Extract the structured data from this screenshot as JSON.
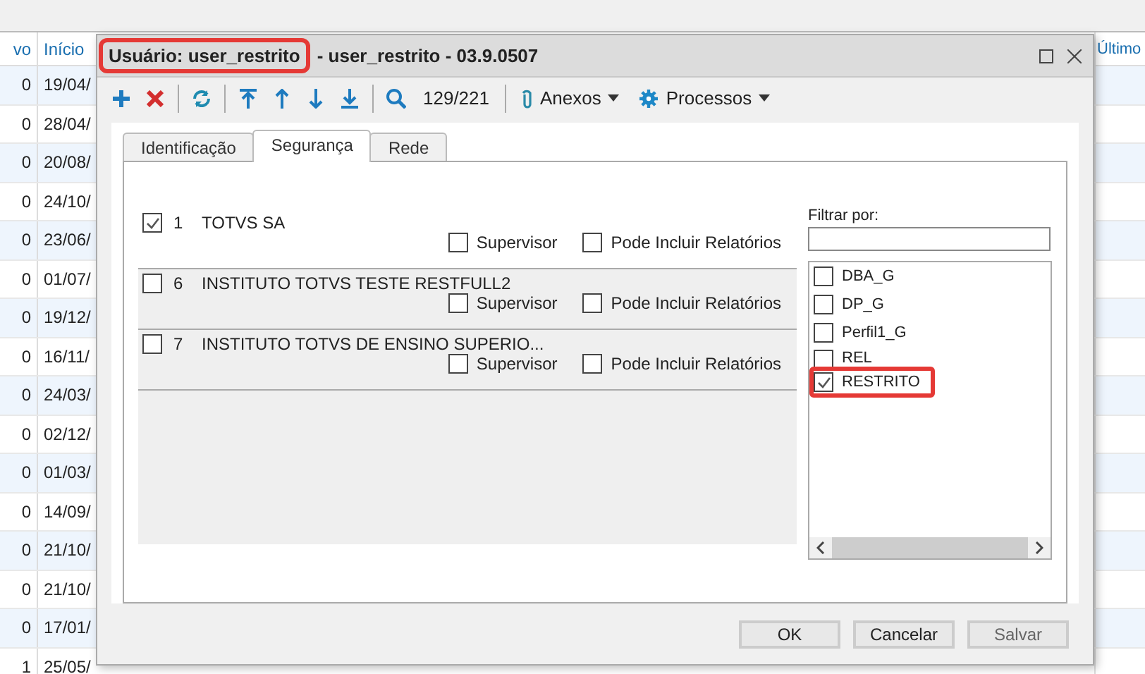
{
  "background_table": {
    "columns": [
      "vo",
      "Início",
      "Último"
    ],
    "rows": [
      {
        "value": "0",
        "date": "19/04/"
      },
      {
        "value": "0",
        "date": "28/04/"
      },
      {
        "value": "0",
        "date": "20/08/"
      },
      {
        "value": "0",
        "date": "24/10/"
      },
      {
        "value": "0",
        "date": "23/06/"
      },
      {
        "value": "0",
        "date": "01/07/"
      },
      {
        "value": "0",
        "date": "19/12/"
      },
      {
        "value": "0",
        "date": "16/11/"
      },
      {
        "value": "0",
        "date": "24/03/"
      },
      {
        "value": "0",
        "date": "02/12/"
      },
      {
        "value": "0",
        "date": "01/03/"
      },
      {
        "value": "0",
        "date": "14/09/"
      },
      {
        "value": "0",
        "date": "21/10/"
      },
      {
        "value": "0",
        "date": "21/10/"
      },
      {
        "value": "0",
        "date": "17/01/"
      },
      {
        "value": "1",
        "date": "25/05/"
      }
    ]
  },
  "window": {
    "title_parts": [
      {
        "text": "Usuário: user_restrito",
        "highlighted": true
      },
      {
        "text": "- user_restrito - 03.9.0507",
        "highlighted": false
      }
    ]
  },
  "toolbar": {
    "record_counter": "129/221",
    "menus": [
      {
        "label": "Anexos"
      },
      {
        "label": "Processos"
      }
    ]
  },
  "tabs": [
    {
      "label": "Identificação",
      "selected": false
    },
    {
      "label": "Segurança",
      "selected": true
    },
    {
      "label": "Rede",
      "selected": false
    }
  ],
  "companies": [
    {
      "number": "1",
      "name": "TOTVS SA",
      "checked": true,
      "supervisor_label": "Supervisor",
      "supervisor": false,
      "reports_label": "Pode Incluir Relatórios",
      "reports": false
    },
    {
      "number": "6",
      "name": "INSTITUTO TOTVS TESTE RESTFULL2",
      "checked": false,
      "supervisor_label": "Supervisor",
      "supervisor": false,
      "reports_label": "Pode Incluir Relatórios",
      "reports": false
    },
    {
      "number": "7",
      "name": "INSTITUTO TOTVS DE ENSINO SUPERIO...",
      "checked": false,
      "supervisor_label": "Supervisor",
      "supervisor": false,
      "reports_label": "Pode Incluir Relatórios",
      "reports": false
    }
  ],
  "filter": {
    "label": "Filtrar por:"
  },
  "groups": [
    {
      "label": "DBA_G",
      "checked": false,
      "highlighted": false
    },
    {
      "label": "DP_G",
      "checked": false,
      "highlighted": false
    },
    {
      "label": "Perfil1_G",
      "checked": false,
      "highlighted": false
    },
    {
      "label": "REL",
      "checked": false,
      "highlighted": false
    },
    {
      "label": "RESTRITO",
      "checked": true,
      "highlighted": true
    }
  ],
  "buttons": [
    {
      "label": "OK",
      "disabled": false
    },
    {
      "label": "Cancelar",
      "disabled": false
    },
    {
      "label": "Salvar",
      "disabled": true
    }
  ]
}
